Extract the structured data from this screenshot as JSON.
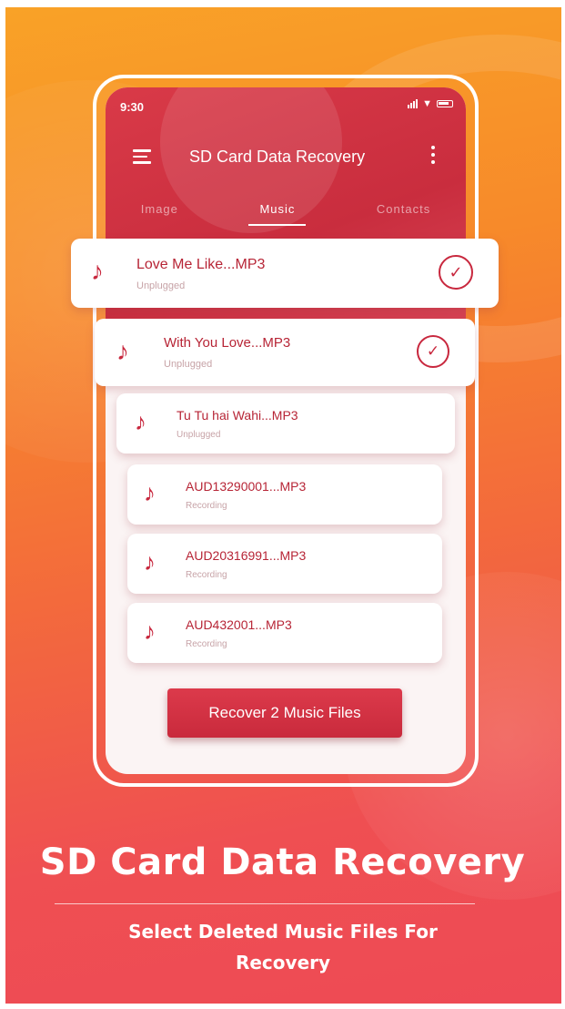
{
  "status_bar": {
    "time": "9:30"
  },
  "app_bar": {
    "title": "SD Card Data Recovery"
  },
  "tabs": [
    {
      "label": "Image",
      "active": false
    },
    {
      "label": "Music",
      "active": true
    },
    {
      "label": "Contacts",
      "active": false
    }
  ],
  "files": [
    {
      "name": "Love Me Like...MP3",
      "sub": "Unplugged",
      "selected": true
    },
    {
      "name": "With You Love...MP3",
      "sub": "Unplugged",
      "selected": true
    },
    {
      "name": "Tu Tu hai Wahi...MP3",
      "sub": "Unplugged",
      "selected": false
    },
    {
      "name": "AUD13290001...MP3",
      "sub": "Recording",
      "selected": false
    },
    {
      "name": "AUD20316991...MP3",
      "sub": "Recording",
      "selected": false
    },
    {
      "name": "AUD432001...MP3",
      "sub": "Recording",
      "selected": false
    }
  ],
  "recover_button": {
    "label": "Recover 2 Music Files"
  },
  "promo": {
    "headline": "SD Card Data Recovery",
    "subline": "Select Deleted Music Files For Recovery"
  },
  "colors": {
    "accent": "#c8283e",
    "gradient_top": "#f9a227",
    "gradient_bottom": "#ee4a55"
  },
  "icons": [
    "menu-icon",
    "more-vert-icon",
    "music-note-icon",
    "check-circle-icon",
    "signal-icon",
    "wifi-icon",
    "battery-icon"
  ]
}
